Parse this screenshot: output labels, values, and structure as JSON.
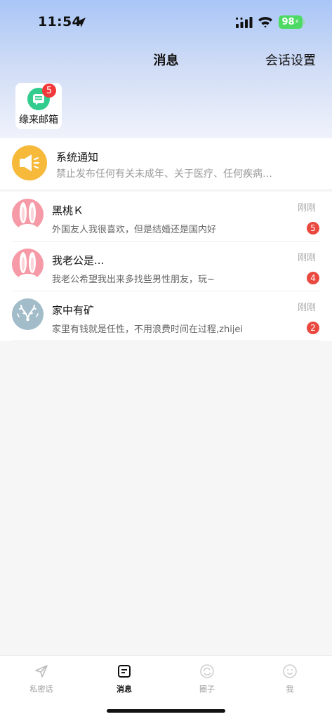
{
  "status_bar": {
    "time": "11:54",
    "battery": "98",
    "icons": [
      "location-arrow-icon",
      "cellular-signal-icon",
      "wifi-icon",
      "battery-charging-icon"
    ]
  },
  "nav": {
    "title": "消息",
    "right_action": "会话设置"
  },
  "mailbox": {
    "label": "缘来邮箱",
    "badge": "5",
    "icon": "chat-bubble-icon",
    "icon_color": "#33cc8f",
    "badge_color": "#f2383a"
  },
  "system_notice": {
    "title": "系统通知",
    "description": "禁止发布任何有关未成年、关于医疗、任何疾病…",
    "icon": "megaphone-icon",
    "icon_color": "#f6b93a"
  },
  "conversations": [
    {
      "name": "黑桃Ｋ",
      "message": "外国友人我很喜欢，但是结婚还是国内好",
      "time": "刚刚",
      "unread": "5",
      "avatar": "pink-bunny-avatar"
    },
    {
      "name": "我老公是...",
      "message": "我老公希望我出来多找些男性朋友，玩~",
      "time": "刚刚",
      "unread": "4",
      "avatar": "pink-bunny-avatar"
    },
    {
      "name": "家中有矿",
      "message": "家里有钱就是任性，不用浪费时间在过程,zhijei",
      "time": "刚刚",
      "unread": "2",
      "avatar": "antler-avatar"
    }
  ],
  "tabs": [
    {
      "label": "私密话",
      "icon": "paper-plane-icon",
      "active": false
    },
    {
      "label": "消息",
      "icon": "message-square-icon",
      "active": true
    },
    {
      "label": "圈子",
      "icon": "circle-refresh-icon",
      "active": false
    },
    {
      "label": "我",
      "icon": "smiley-face-icon",
      "active": false
    }
  ],
  "colors": {
    "header_gradient_top": "#a9c6f7",
    "unread_badge": "#e9493e",
    "battery": "#4cd964"
  }
}
